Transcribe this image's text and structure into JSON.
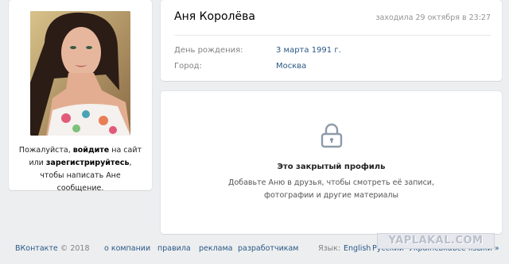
{
  "profile": {
    "name": "Аня Королёва",
    "last_seen": "заходила 29 октября в 23:27",
    "info": [
      {
        "label": "День рождения:",
        "value": "3 марта 1991 г."
      },
      {
        "label": "Город:",
        "value": "Москва"
      }
    ]
  },
  "guest_message": {
    "part1": "Пожалуйста, ",
    "login_link": "войдите",
    "part2": " на сайт или ",
    "register_link": "зарегистрируйтесь",
    "part3": ", чтобы написать Ане сообщение."
  },
  "private_profile": {
    "icon": "lock-icon",
    "title": "Это закрытый профиль",
    "description": "Добавьте Аню в друзья, чтобы смотреть её записи, фотографии и другие материалы"
  },
  "footer": {
    "brand": "ВКонтакте",
    "copyright": "© 2018",
    "links": [
      "о компании",
      "правила",
      "реклама",
      "разработчикам"
    ],
    "language_label": "Язык:",
    "languages": [
      "English",
      "Русский",
      "Українська"
    ],
    "all_languages": "все языки »"
  },
  "watermark": "YAPLAKAL.COM",
  "colors": {
    "background": "#edeef0",
    "card": "#ffffff",
    "link": "#2a5885",
    "muted": "#828282"
  }
}
